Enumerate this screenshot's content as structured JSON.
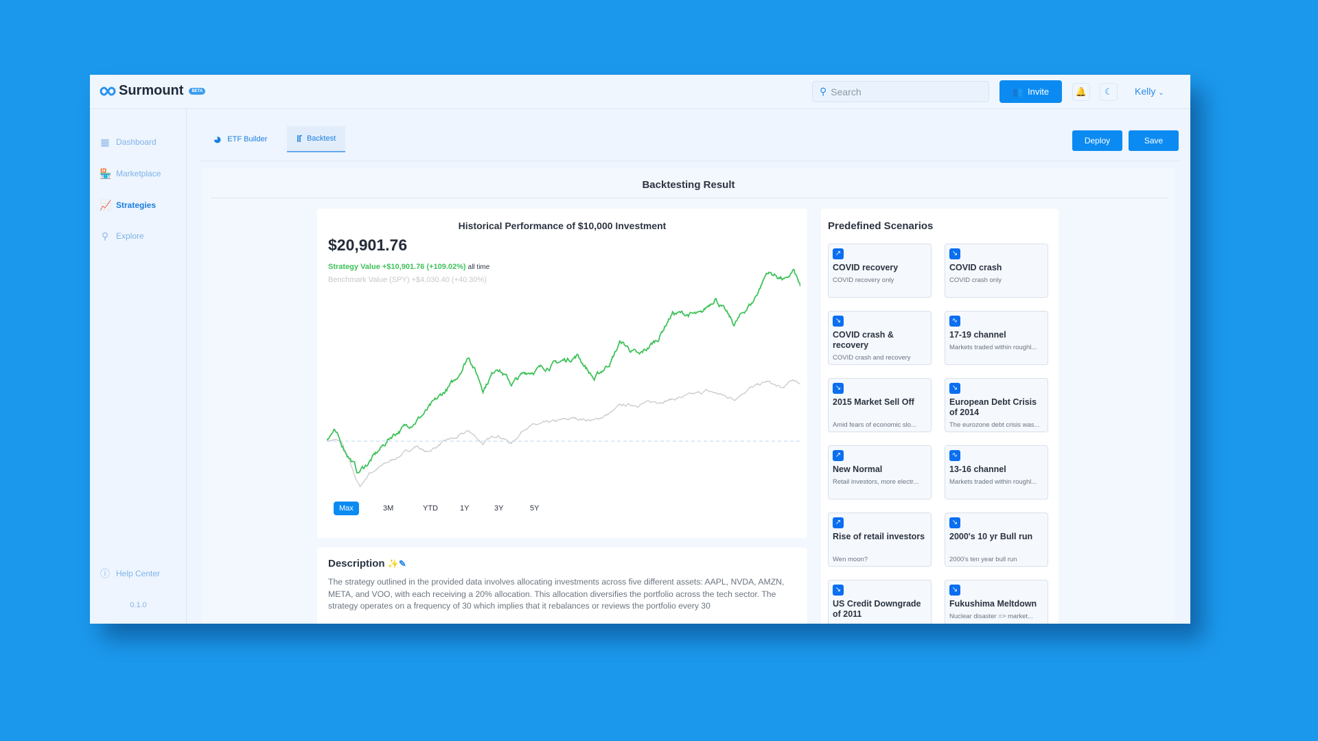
{
  "app": {
    "name": "Surmount",
    "badge": "BETA"
  },
  "header": {
    "search_placeholder": "Search",
    "invite_label": "Invite",
    "user": "Kelly",
    "icons": [
      "search-icon",
      "invite-users-icon",
      "bell-icon",
      "moon-icon",
      "chevron-down-icon"
    ]
  },
  "sidebar": {
    "items": [
      {
        "label": "Dashboard",
        "icon": "dashboard-icon",
        "active": false
      },
      {
        "label": "Marketplace",
        "icon": "store-icon",
        "active": false
      },
      {
        "label": "Strategies",
        "icon": "chart-icon",
        "active": true
      },
      {
        "label": "Explore",
        "icon": "search-icon",
        "active": false
      }
    ],
    "help": "Help Center",
    "version": "0.1.0"
  },
  "tabs": [
    {
      "label": "ETF Builder",
      "active": false
    },
    {
      "label": "Backtest",
      "active": true
    }
  ],
  "actions": {
    "deploy": "Deploy",
    "save": "Save"
  },
  "panel": {
    "title": "Backtesting Result"
  },
  "performance": {
    "title": "Historical Performance of $10,000 Investment",
    "value": "$20,901.76",
    "strategy_text": "Strategy Value +$10,901.76 (+109.02%)",
    "strategy_suffix": "all time",
    "benchmark_text": "Benchmark Value (SPY) +$4,030.40 (+40.30%)",
    "ranges": [
      "Max",
      "3M",
      "YTD",
      "1Y",
      "3Y",
      "5Y"
    ],
    "active_range": "Max"
  },
  "chart_data": {
    "type": "line",
    "baseline": 10000,
    "grid": false,
    "axes_visible": false,
    "colors": {
      "strategy": "#3ec25a",
      "benchmark": "#c8cacd",
      "baseline": "#b9d6f5"
    },
    "x": [
      0,
      0.015,
      0.03,
      0.06,
      0.065,
      0.07,
      0.09,
      0.14,
      0.19,
      0.21,
      0.26,
      0.27,
      0.3,
      0.33,
      0.36,
      0.39,
      0.42,
      0.47,
      0.52,
      0.53,
      0.565,
      0.6,
      0.62,
      0.66,
      0.67,
      0.7,
      0.72,
      0.73,
      0.79,
      0.8,
      0.82,
      0.86,
      0.89,
      0.9,
      0.93,
      0.96,
      0.97,
      0.985,
      1.0
    ],
    "series": [
      {
        "key": "strategy",
        "values": [
          10160,
          10720,
          9840,
          8230,
          7750,
          7900,
          8550,
          10480,
          11500,
          12090,
          13860,
          14200,
          16040,
          13700,
          15310,
          14030,
          14830,
          15310,
          15900,
          16040,
          14350,
          15640,
          17000,
          15960,
          16300,
          17250,
          18500,
          19020,
          18850,
          19300,
          20140,
          18210,
          19500,
          19820,
          21910,
          21500,
          21270,
          21990,
          20901.76
        ]
      },
      {
        "key": "benchmark",
        "values": [
          10000,
          10050,
          10000,
          7500,
          7100,
          6780,
          7750,
          8710,
          9680,
          9200,
          10160,
          10160,
          10720,
          9840,
          10480,
          9840,
          11000,
          11300,
          11610,
          11600,
          11450,
          12000,
          12500,
          12600,
          12660,
          12800,
          12900,
          12950,
          13400,
          13540,
          13400,
          12980,
          13700,
          13800,
          14190,
          13700,
          13900,
          14350,
          14030.4
        ]
      }
    ]
  },
  "scenarios": {
    "title": "Predefined Scenarios",
    "items": [
      {
        "name": "COVID recovery",
        "desc": "COVID recovery only",
        "trend": "up"
      },
      {
        "name": "COVID crash",
        "desc": "COVID crash only",
        "trend": "down"
      },
      {
        "name": "COVID crash & recovery",
        "desc": "COVID crash and recovery",
        "trend": "down"
      },
      {
        "name": "17-19 channel",
        "desc": "Markets traded within roughl...",
        "trend": "channel"
      },
      {
        "name": "2015 Market Sell Off",
        "desc": "Amid fears of economic slo...",
        "trend": "down"
      },
      {
        "name": "European Debt Crisis of 2014",
        "desc": "The eurozone debt crisis was...",
        "trend": "down"
      },
      {
        "name": "New Normal",
        "desc": "Retail investors, more electr...",
        "trend": "up"
      },
      {
        "name": "13-16 channel",
        "desc": "Markets traded within roughl...",
        "trend": "channel"
      },
      {
        "name": "Rise of retail investors",
        "desc": "Wen moon?",
        "trend": "up"
      },
      {
        "name": "2000's 10 yr Bull run",
        "desc": "2000's ten year bull run",
        "trend": "down"
      },
      {
        "name": "US Credit Downgrade of 2011",
        "desc": "",
        "trend": "down"
      },
      {
        "name": "Fukushima Meltdown",
        "desc": "Nuclear disaster => market...",
        "trend": "down"
      }
    ]
  },
  "description": {
    "title": "Description",
    "text": "The strategy outlined in the provided data involves allocating investments across five different assets: AAPL, NVDA, AMZN, META, and VOO, with each receiving a 20% allocation. This allocation diversifies the portfolio across the tech sector. The strategy operates on a frequency of 30 which implies that it rebalances or reviews the portfolio every 30"
  }
}
